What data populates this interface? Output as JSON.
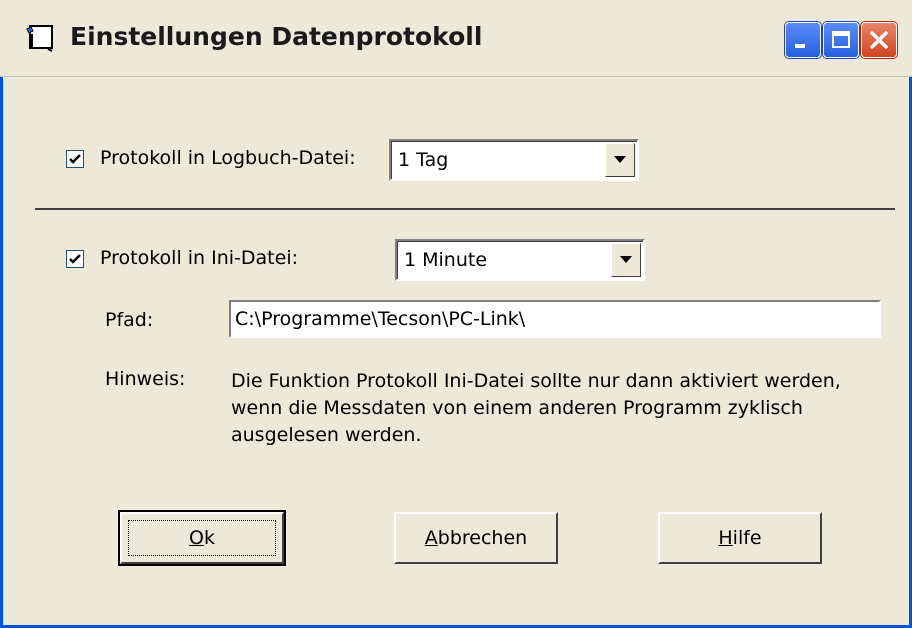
{
  "window": {
    "title": "Einstellungen Datenprotokoll",
    "controls": [
      "minimize-icon",
      "maximize-icon",
      "close-icon"
    ],
    "accent_color": "#0054e3",
    "background_color": "#ece9d8"
  },
  "logbook": {
    "checked": true,
    "label": "Protokoll in Logbuch-Datei:",
    "interval_value": "1 Tag"
  },
  "ini": {
    "checked": true,
    "label": "Protokoll in Ini-Datei:",
    "interval_value": "1 Minute"
  },
  "path": {
    "label": "Pfad:",
    "value": "C:\\Programme\\Tecson\\PC-Link\\"
  },
  "hint": {
    "label": "Hinweis:",
    "text": "Die Funktion Protokoll Ini-Datei sollte nur dann aktiviert werden, wenn die Messdaten von einem anderen Programm zyklisch ausgelesen werden."
  },
  "buttons": {
    "ok": {
      "mnemonic": "O",
      "rest": "k"
    },
    "cancel": {
      "mnemonic": "A",
      "rest": "bbrechen"
    },
    "help": {
      "mnemonic": "H",
      "rest": "ilfe"
    }
  }
}
